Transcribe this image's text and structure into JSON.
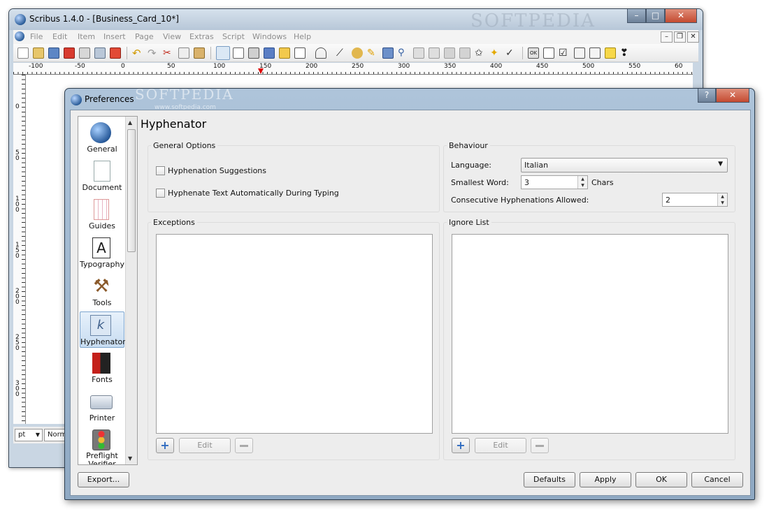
{
  "main_window": {
    "title": "Scribus 1.4.0 - [Business_Card_10*]",
    "watermark": "SOFTPEDIA",
    "menu": [
      "File",
      "Edit",
      "Item",
      "Insert",
      "Page",
      "View",
      "Extras",
      "Script",
      "Windows",
      "Help"
    ],
    "ruler_marks": [
      "-100",
      "-50",
      "0",
      "50",
      "100",
      "150",
      "200",
      "250",
      "300",
      "350",
      "400",
      "450",
      "500",
      "550",
      "60"
    ],
    "vruler_marks": [
      "0",
      "5\n0",
      "1\n0\n0",
      "1\n5\n0",
      "2\n0\n0",
      "2\n5\n0",
      "3\n0\n0"
    ],
    "unit_select": "pt",
    "mode_select": "Norm"
  },
  "dialog": {
    "title": "Preferences",
    "watermark": "SOFTPEDIA",
    "watermark_url": "www.softpedia.com",
    "sidebar": [
      {
        "label": "General",
        "icon": "globe-icon"
      },
      {
        "label": "Document",
        "icon": "document-icon"
      },
      {
        "label": "Guides",
        "icon": "guides-icon"
      },
      {
        "label": "Typography",
        "icon": "typography-icon"
      },
      {
        "label": "Tools",
        "icon": "hammer-icon"
      },
      {
        "label": "Hyphenator",
        "icon": "hyphenator-icon"
      },
      {
        "label": "Fonts",
        "icon": "fonts-icon"
      },
      {
        "label": "Printer",
        "icon": "printer-icon"
      },
      {
        "label": "Preflight Verifier",
        "icon": "traffic-light-icon"
      }
    ],
    "selected": "Hyphenator",
    "page_title": "Hyphenator",
    "general_options": {
      "title": "General Options",
      "hyphenation_suggestions": "Hyphenation Suggestions",
      "hyphenate_automatically": "Hyphenate Text Automatically During Typing"
    },
    "behaviour": {
      "title": "Behaviour",
      "language_label": "Language:",
      "language_value": "Italian",
      "smallest_word_label": "Smallest Word:",
      "smallest_word_value": "3",
      "smallest_word_unit": "Chars",
      "consecutive_label": "Consecutive Hyphenations Allowed:",
      "consecutive_value": "2"
    },
    "exceptions": {
      "title": "Exceptions",
      "edit_label": "Edit"
    },
    "ignore_list": {
      "title": "Ignore List",
      "edit_label": "Edit"
    },
    "buttons": {
      "export": "Export...",
      "defaults": "Defaults",
      "apply": "Apply",
      "ok": "OK",
      "cancel": "Cancel"
    }
  }
}
